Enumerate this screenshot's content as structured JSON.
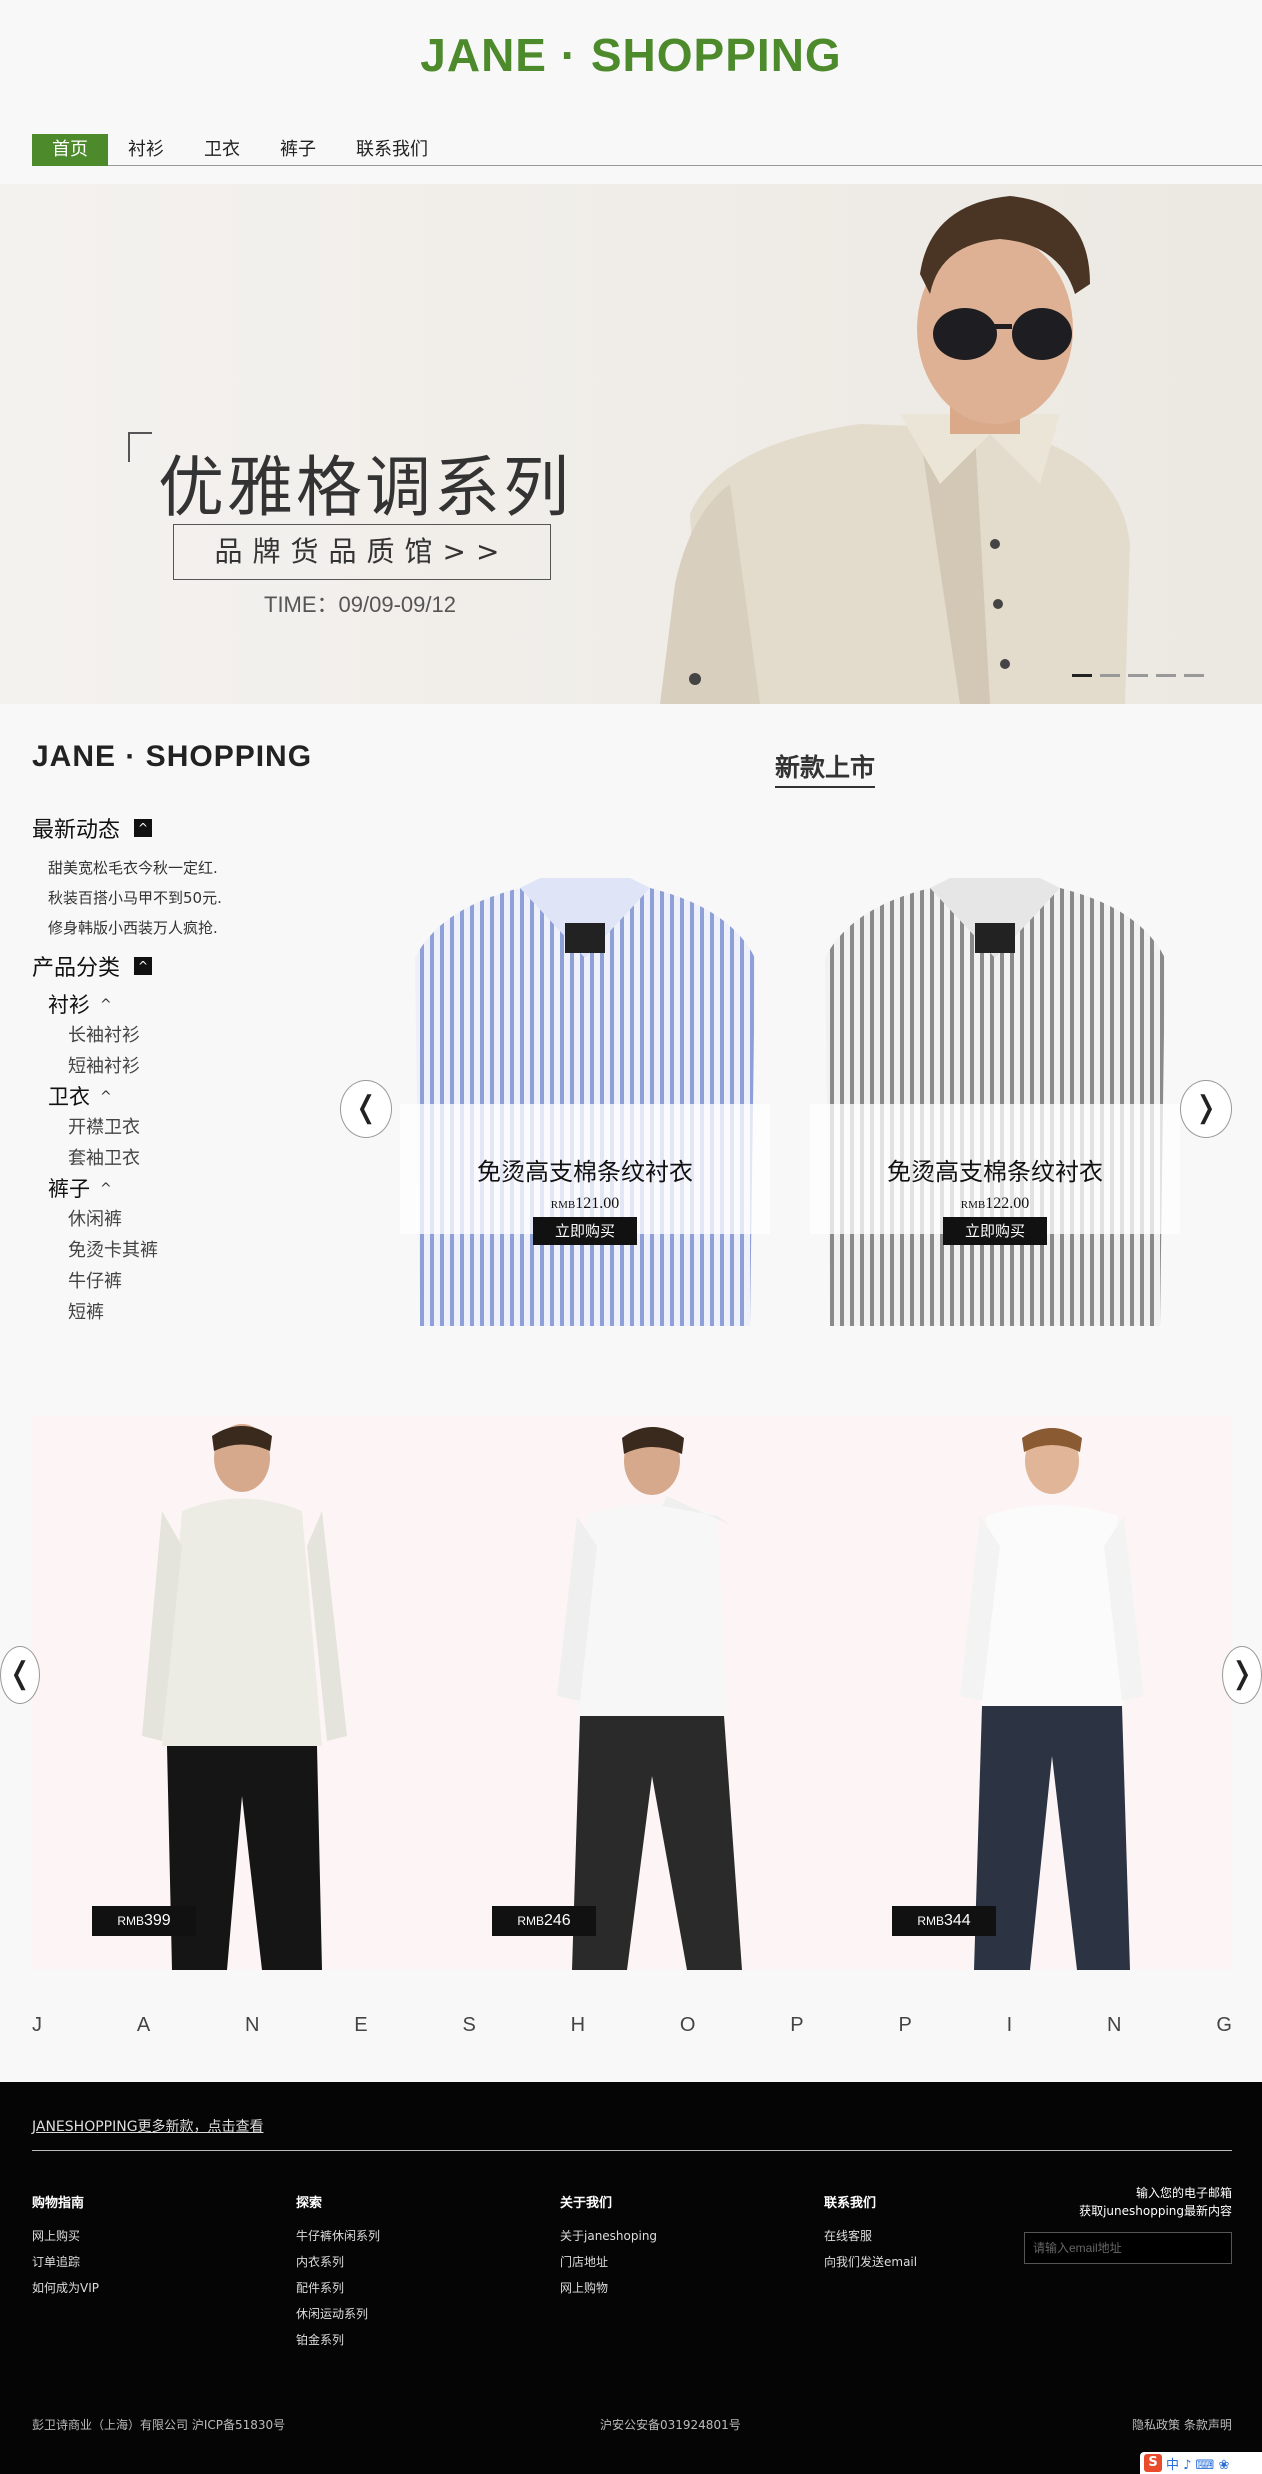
{
  "brand": {
    "title": "JANE · SHOPPING",
    "color": "#4d8a2c"
  },
  "nav": {
    "items": [
      "首页",
      "衬衫",
      "卫衣",
      "裤子",
      "联系我们"
    ],
    "active_index": 0
  },
  "hero": {
    "title": "优雅格调系列",
    "cta": "品牌货品质馆>>",
    "time": "TIME：09/09-09/12",
    "slide_count": 5,
    "active_slide": 0
  },
  "sidebar": {
    "brand": "JANE · SHOPPING",
    "news_heading": "最新动态",
    "news": [
      "甜美宽松毛衣今秋一定红.",
      "秋装百搭小马甲不到50元.",
      "修身韩版小西装万人疯抢."
    ],
    "category_heading": "产品分类",
    "categories": [
      {
        "name": "衬衫",
        "items": [
          "长袖衬衫",
          "短袖衬衫"
        ]
      },
      {
        "name": "卫衣",
        "items": [
          "开襟卫衣",
          "套袖卫衣"
        ]
      },
      {
        "name": "裤子",
        "items": [
          "休闲裤",
          "免烫卡其裤",
          "牛仔裤",
          "短裤"
        ]
      }
    ],
    "toggle_icon": "^",
    "caret_icon": "^"
  },
  "new_arrivals": {
    "heading": "新款上市",
    "products": [
      {
        "name": "免烫高支棉条纹衬衣",
        "currency": "RMB",
        "price": "121.00",
        "buy_label": "立即购买",
        "stripe_color": "#8f9fd8"
      },
      {
        "name": "免烫高支棉条纹衬衣",
        "currency": "RMB",
        "price": "122.00",
        "buy_label": "立即购买",
        "stripe_color": "#8a8a8a"
      }
    ]
  },
  "arrows": {
    "prev": "❬",
    "next": "❭"
  },
  "models": [
    {
      "currency": "RMB",
      "price": "399",
      "pants_color": "#151515"
    },
    {
      "currency": "RMB",
      "price": "246",
      "pants_color": "#2a2a2a"
    },
    {
      "currency": "RMB",
      "price": "344",
      "pants_color": "#2c3444"
    }
  ],
  "spaced_letters": [
    "J",
    "A",
    "N",
    "E",
    "S",
    "H",
    "O",
    "P",
    "P",
    "I",
    "N",
    "G"
  ],
  "footer": {
    "more_link": "JANESHOPPING更多新款，点击查看",
    "columns": [
      {
        "title": "购物指南",
        "links": [
          "网上购买",
          "订单追踪",
          "如何成为VIP"
        ]
      },
      {
        "title": "探索",
        "links": [
          "牛仔裤休闲系列",
          "内衣系列",
          "配件系列",
          "休闲运动系列",
          "铂金系列"
        ]
      },
      {
        "title": "关于我们",
        "links": [
          "关于janeshoping",
          "门店地址",
          "网上购物"
        ]
      },
      {
        "title": "联系我们",
        "links": [
          "在线客服",
          "向我们发送email"
        ]
      }
    ],
    "newsletter_line1": "输入您的电子邮箱",
    "newsletter_line2": "获取juneshopping最新内容",
    "email_placeholder": "请输入email地址",
    "company": "彭卫诗商业（上海）有限公司 沪ICP备51830号",
    "police": "沪安公安备031924801号",
    "privacy": "隐私政策",
    "terms": "条款声明"
  },
  "ime_bar": {
    "logo": "S",
    "text": "中 ♪ ⌨ ❀"
  }
}
